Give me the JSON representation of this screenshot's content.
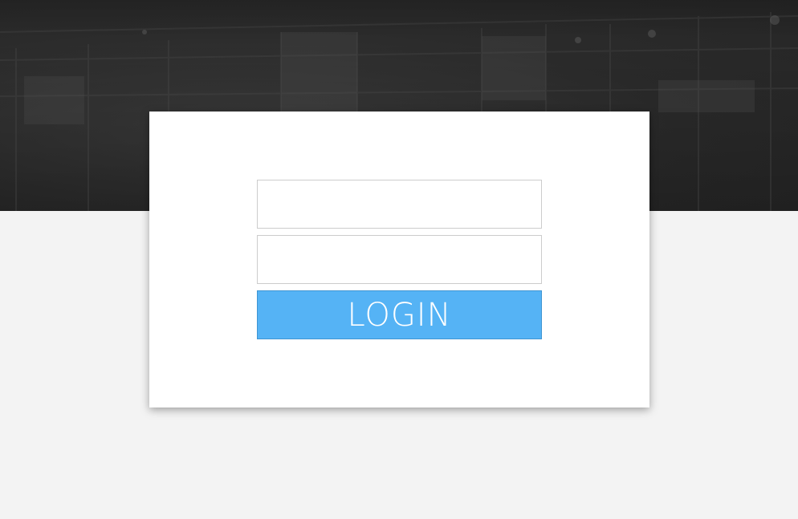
{
  "login_form": {
    "username_value": "",
    "password_value": "",
    "login_label": "LOGIN"
  },
  "colors": {
    "banner_bg": "#2b2b2b",
    "page_bg": "#f3f3f3",
    "card_bg": "#ffffff",
    "button_bg": "#55b3f5",
    "button_text": "#ffffff"
  }
}
